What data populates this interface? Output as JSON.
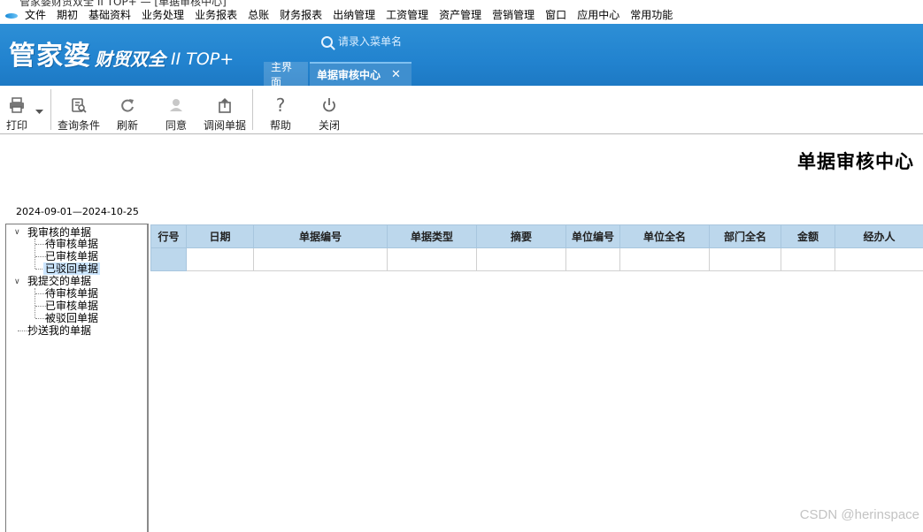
{
  "window": {
    "title_partial": "管家婆财贸双全 II TOP+ — [单据审核中心]"
  },
  "menu": [
    "文件",
    "期初",
    "基础资料",
    "业务处理",
    "业务报表",
    "总账",
    "财务报表",
    "出纳管理",
    "工资管理",
    "资产管理",
    "营销管理",
    "窗口",
    "应用中心",
    "常用功能"
  ],
  "banner": {
    "logo_main": "管家婆",
    "logo_sub": "财贸双全",
    "logo_version": "II TOP+",
    "search_placeholder": "请录入菜单名",
    "tabs": {
      "home": "主界面",
      "active": "单据审核中心",
      "close": "✕"
    }
  },
  "toolbar": {
    "print": "打印",
    "query": "查询条件",
    "refresh": "刷新",
    "approve": "同意",
    "review": "调阅单据",
    "help": "帮助",
    "close": "关闭"
  },
  "page": {
    "title": "单据审核中心",
    "date_range": "2024-09-01—2024-10-25"
  },
  "tree": {
    "group1": {
      "label": "我审核的单据",
      "items": [
        "待审核单据",
        "已审核单据",
        "已驳回单据"
      ]
    },
    "group2": {
      "label": "我提交的单据",
      "items": [
        "待审核单据",
        "已审核单据",
        "被驳回单据"
      ]
    },
    "group3": {
      "label": "抄送我的单据"
    },
    "selected": "group1.2"
  },
  "grid": {
    "columns": [
      "行号",
      "日期",
      "单据编号",
      "单据类型",
      "摘要",
      "单位编号",
      "单位全名",
      "部门全名",
      "金额",
      "经办人"
    ]
  },
  "watermark": "CSDN @herinspace",
  "colors": {
    "banner": "#2283cf",
    "grid_header": "#bcd7ec",
    "tree_selected": "#cce6ff"
  }
}
